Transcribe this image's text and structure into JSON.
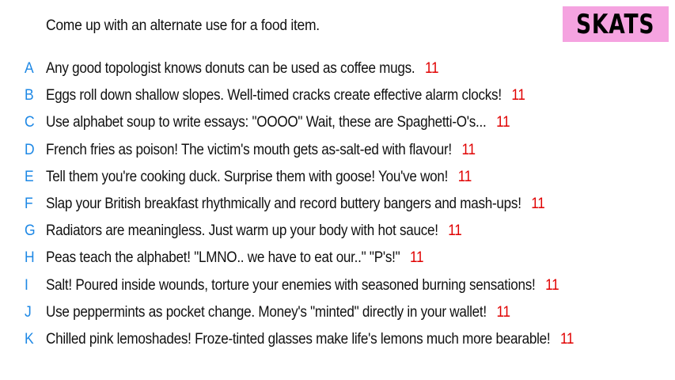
{
  "prompt": "Come up with an alternate use for a food item.",
  "logo": {
    "text": "SKATS",
    "background": "#f5a3e0"
  },
  "colors": {
    "letter": "#1e88e5",
    "score": "#e00000",
    "text": "#111111"
  },
  "answers": [
    {
      "letter": "A",
      "text": "Any good topologist knows donuts can be used as coffee mugs.",
      "score": "11"
    },
    {
      "letter": "B",
      "text": "Eggs roll down shallow slopes. Well-timed cracks create effective alarm clocks!",
      "score": "11"
    },
    {
      "letter": "C",
      "text": "Use alphabet soup to write essays: \"OOOO\" Wait, these are Spaghetti-O's...",
      "score": "11"
    },
    {
      "letter": "D",
      "text": "French fries as poison! The victim's mouth gets as-salt-ed with flavour!",
      "score": "11"
    },
    {
      "letter": "E",
      "text": "Tell them you're cooking duck. Surprise them with goose! You've won!",
      "score": "11"
    },
    {
      "letter": "F",
      "text": "Slap your British breakfast rhythmically and record buttery bangers and mash-ups!",
      "score": "11"
    },
    {
      "letter": "G",
      "text": "Radiators are meaningless. Just warm up your body with hot sauce!",
      "score": "11"
    },
    {
      "letter": "H",
      "text": "Peas teach the alphabet! \"LMNO.. we have to eat our..\" \"P's!\"",
      "score": "11"
    },
    {
      "letter": "I",
      "text": "Salt! Poured inside wounds, torture your enemies with seasoned burning sensations!",
      "score": "11"
    },
    {
      "letter": "J",
      "text": "Use peppermints as pocket change. Money's \"minted\" directly in your wallet!",
      "score": "11"
    },
    {
      "letter": "K",
      "text": "Chilled pink lemoshades! Froze-tinted glasses make life's lemons much more bearable!",
      "score": "11"
    }
  ]
}
